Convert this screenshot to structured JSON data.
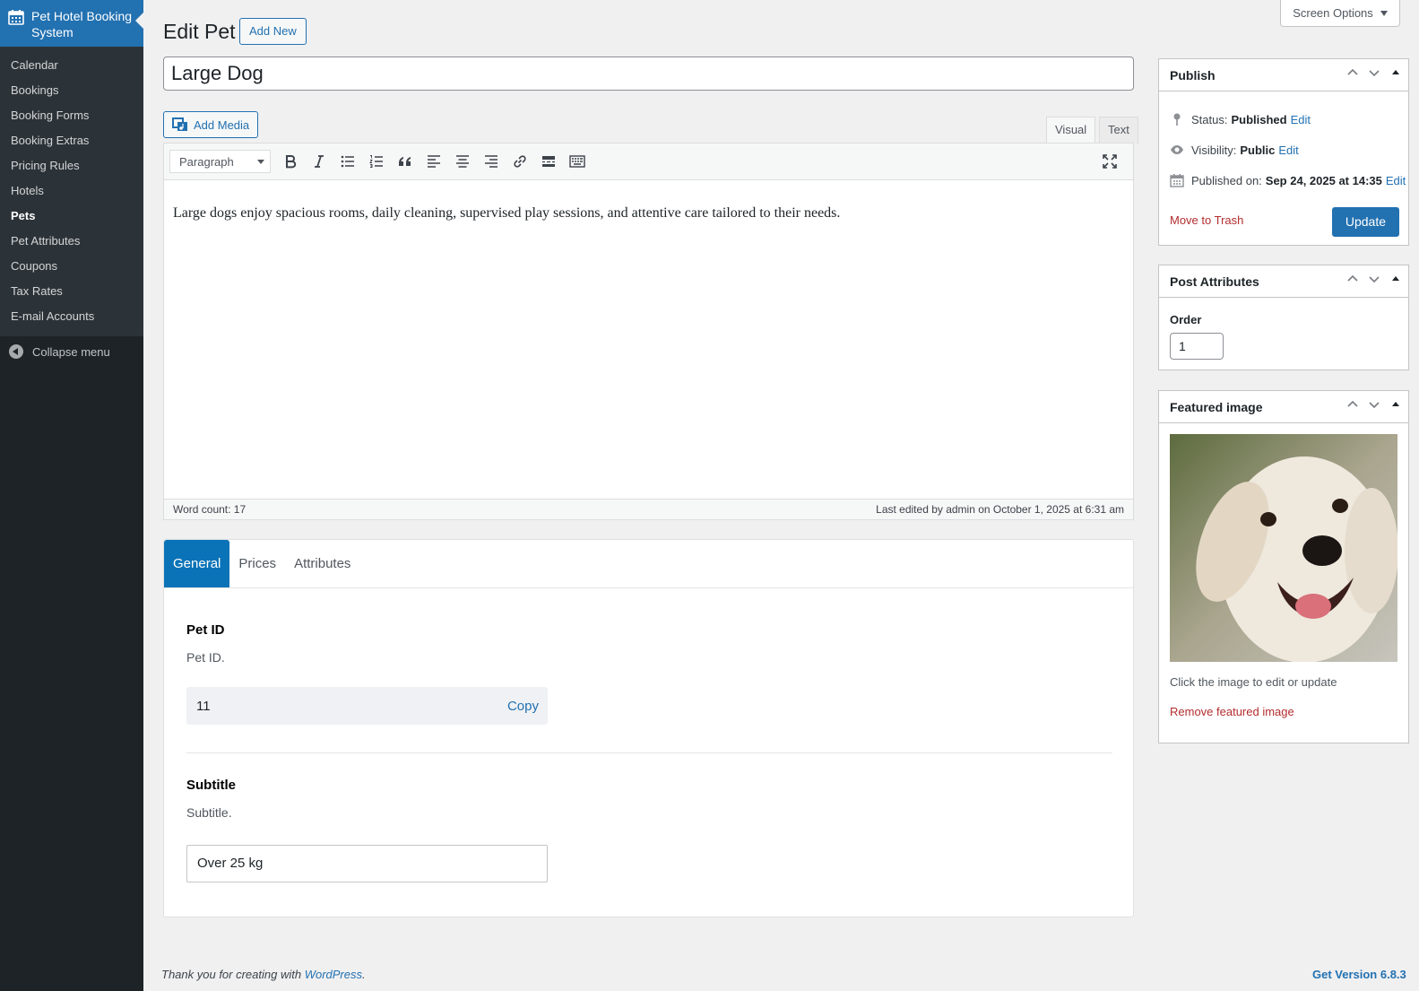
{
  "sidebar": {
    "brand": "Pet Hotel Booking System",
    "items": [
      {
        "label": "Calendar"
      },
      {
        "label": "Bookings"
      },
      {
        "label": "Booking Forms"
      },
      {
        "label": "Booking Extras"
      },
      {
        "label": "Pricing Rules"
      },
      {
        "label": "Hotels"
      },
      {
        "label": "Pets"
      },
      {
        "label": "Pet Attributes"
      },
      {
        "label": "Coupons"
      },
      {
        "label": "Tax Rates"
      },
      {
        "label": "E-mail Accounts"
      }
    ],
    "current": "Pets",
    "collapse_label": "Collapse menu"
  },
  "header": {
    "title": "Edit Pet",
    "add_new": "Add New",
    "screen_options": "Screen Options"
  },
  "post": {
    "title": "Large Dog"
  },
  "editor": {
    "add_media": "Add Media",
    "tabs": {
      "visual": "Visual",
      "text": "Text"
    },
    "format": "Paragraph",
    "content": "Large dogs enjoy spacious rooms, daily cleaning, supervised play sessions, and attentive care tailored to their needs.",
    "word_count": "Word count: 17",
    "last_edited": "Last edited by admin on October 1, 2025 at 6:31 am"
  },
  "meta": {
    "tabs": [
      "General",
      "Prices",
      "Attributes"
    ],
    "active_tab": "General",
    "pet_id": {
      "label": "Pet ID",
      "description": "Pet ID.",
      "value": "11",
      "copy": "Copy"
    },
    "subtitle": {
      "label": "Subtitle",
      "description": "Subtitle.",
      "value": "Over 25 kg"
    }
  },
  "publish": {
    "title": "Publish",
    "status_label": "Status:",
    "status_value": "Published",
    "visibility_label": "Visibility:",
    "visibility_value": "Public",
    "published_label": "Published on:",
    "published_value": "Sep 24, 2025 at 14:35",
    "edit": "Edit",
    "move_to_trash": "Move to Trash",
    "update": "Update"
  },
  "attributes": {
    "title": "Post Attributes",
    "order_label": "Order",
    "order_value": "1"
  },
  "featured": {
    "title": "Featured image",
    "hint": "Click the image to edit or update",
    "remove": "Remove featured image"
  },
  "footer": {
    "thanks_prefix": "Thank you for creating with ",
    "wordpress": "WordPress",
    "thanks_suffix": ".",
    "version": "Get Version 6.8.3"
  },
  "colors": {
    "accent": "#2271b1",
    "sidebar": "#1d2327",
    "tab_active": "#0a73b7",
    "danger": "#b32d2e"
  }
}
